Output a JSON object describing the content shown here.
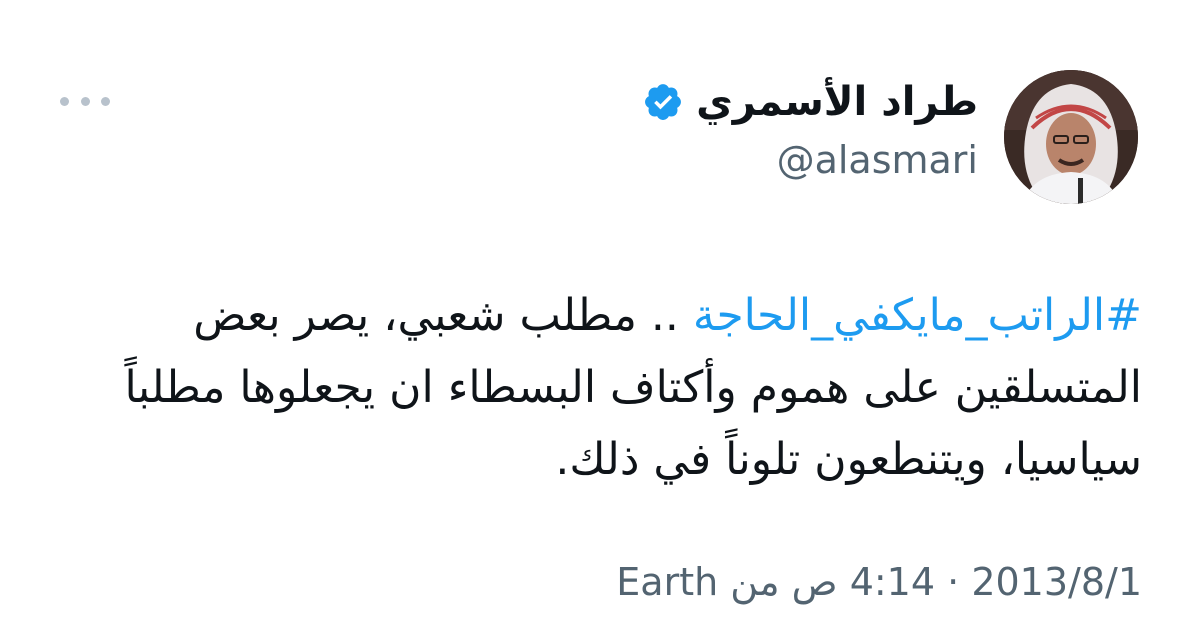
{
  "author": {
    "display_name": "طراد الأسمري",
    "handle": "@alasmari",
    "verified": true
  },
  "tweet": {
    "hashtag": "#الراتب_مايكفي_الحاجة",
    "text_after_hashtag": " .. مطلب شعبي، يصر بعض المتسلقين على هموم وأكتاف البسطاء ان يجعلوها مطلباً سياسيا، ويتنطعون تلوناً في ذلك."
  },
  "meta": {
    "date": "2013/8/1",
    "separator": "·",
    "time": "4:14 ص",
    "source_prefix": "من",
    "source": "Earth"
  },
  "colors": {
    "accent": "#1d9bf0",
    "text_primary": "#0f1419",
    "text_secondary": "#536471"
  },
  "icons": {
    "verified": "verified-badge-icon",
    "more": "more-options-icon"
  }
}
